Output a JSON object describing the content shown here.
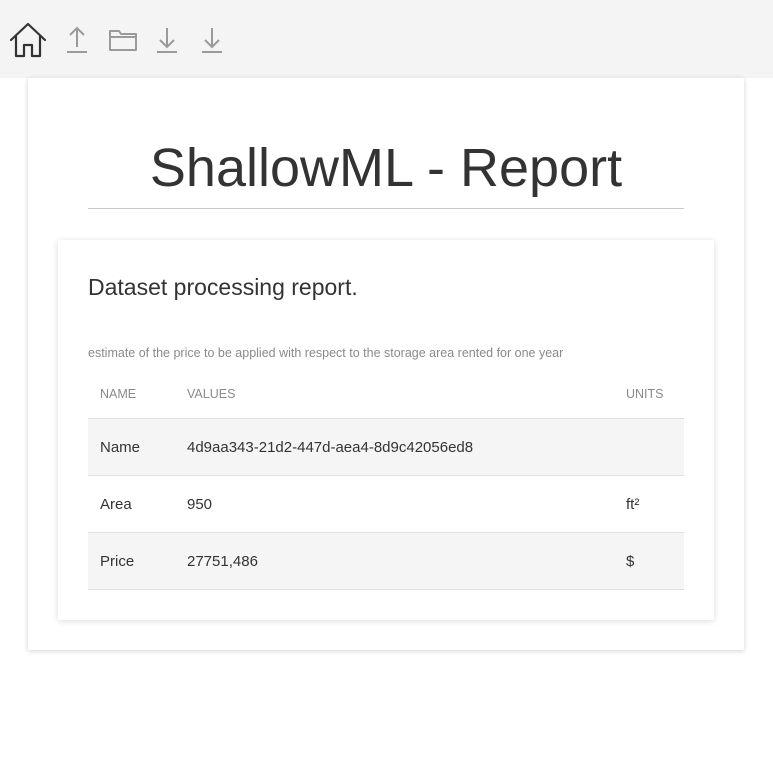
{
  "toolbar": {
    "buttons": [
      {
        "icon": "home-icon"
      },
      {
        "icon": "upload-icon"
      },
      {
        "icon": "folder-icon"
      },
      {
        "icon": "download-icon"
      },
      {
        "icon": "download-icon"
      }
    ]
  },
  "report": {
    "title": "ShallowML - Report",
    "section_title": "Dataset processing report.",
    "caption": "estimate of the price to be applied with respect to the storage area rented for one year",
    "columns": [
      "NAME",
      "VALUES",
      "UNITS"
    ],
    "rows": [
      {
        "name": "Name",
        "value": "4d9aa343-21d2-447d-aea4-8d9c42056ed8",
        "unit": ""
      },
      {
        "name": "Area",
        "value": "950",
        "unit": "ft²"
      },
      {
        "name": "Price",
        "value": "27751,486",
        "unit": "$"
      }
    ]
  },
  "colors": {
    "toolbar_bg": "#f4f4f4",
    "row_shade": "#f5f5f5",
    "icon_stroke": "#333333",
    "icon_stroke_muted": "#9a9a9a"
  }
}
